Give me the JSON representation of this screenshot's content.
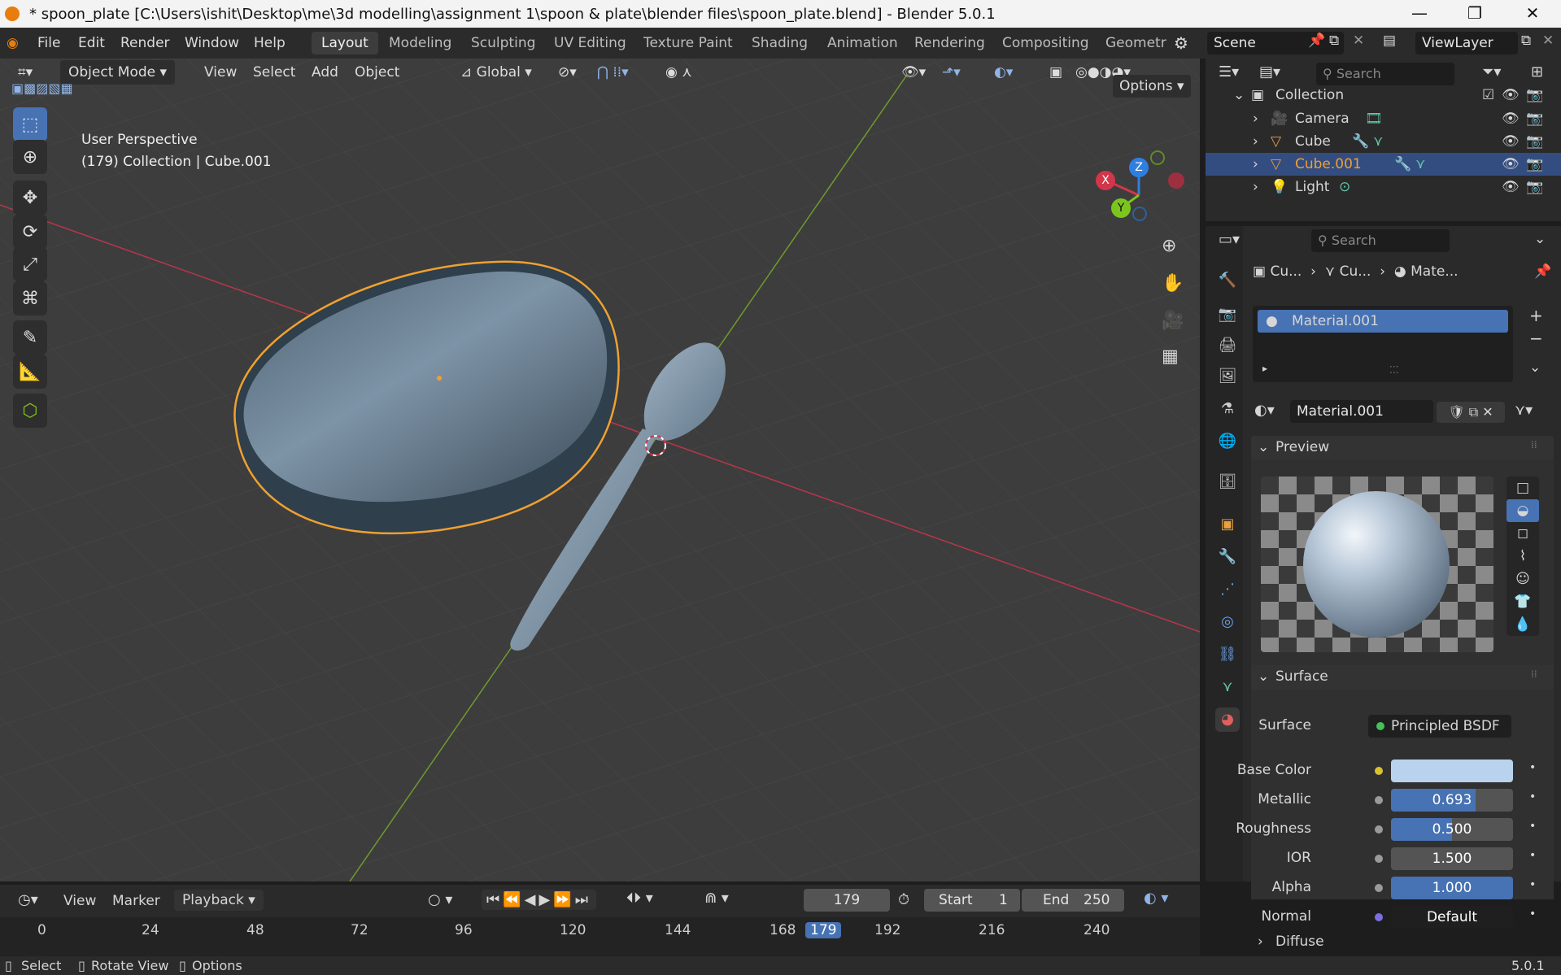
{
  "window": {
    "title": "* spoon_plate [C:\\Users\\ishit\\Desktop\\me\\3d modelling\\assignment 1\\spoon & plate\\blender files\\spoon_plate.blend] - Blender 5.0.1",
    "minimize": "—",
    "maximize": "❐",
    "close": "✕"
  },
  "menu": {
    "file": "File",
    "edit": "Edit",
    "render": "Render",
    "window": "Window",
    "help": "Help"
  },
  "workspaces": [
    "Layout",
    "Modeling",
    "Sculpting",
    "UV Editing",
    "Texture Paint",
    "Shading",
    "Animation",
    "Rendering",
    "Compositing",
    "Geometr"
  ],
  "scene": {
    "name": "Scene",
    "view_layer": "ViewLayer"
  },
  "viewport": {
    "mode": "Object Mode",
    "view": "View",
    "select": "Select",
    "add": "Add",
    "object": "Object",
    "orientation": "Global",
    "options": "Options",
    "info_line1": "User Perspective",
    "info_line2": "(179) Collection | Cube.001",
    "gizmo": {
      "x": "X",
      "y": "Y",
      "z": "Z"
    }
  },
  "outliner": {
    "search_placeholder": "Search",
    "collection": "Collection",
    "items": [
      "Camera",
      "Cube",
      "Cube.001",
      "Light"
    ],
    "selected": "Cube.001"
  },
  "properties": {
    "search_placeholder": "Search",
    "breadcrumb": [
      "Cu...",
      "Cu...",
      "Mate..."
    ],
    "slot": "Material.001",
    "material_name": "Material.001",
    "preview_header": "Preview",
    "surface_header": "Surface",
    "surface_label": "Surface",
    "surface_value": "Principled BSDF",
    "fields": [
      {
        "label": "Base Color",
        "value": "",
        "fill": 1.0,
        "color": "#b9d2ee"
      },
      {
        "label": "Metallic",
        "value": "0.693",
        "fill": 0.693
      },
      {
        "label": "Roughness",
        "value": "0.500",
        "fill": 0.5
      },
      {
        "label": "IOR",
        "value": "1.500",
        "fill": 0
      },
      {
        "label": "Alpha",
        "value": "1.000",
        "fill": 1.0
      },
      {
        "label": "Normal",
        "value": "Default",
        "fill": 0
      }
    ],
    "diffuse_header": "Diffuse"
  },
  "timeline": {
    "view": "View",
    "marker": "Marker",
    "playback": "Playback",
    "current_frame": "179",
    "start_label": "Start",
    "start": "1",
    "end_label": "End",
    "end": "250",
    "frames": [
      "0",
      "24",
      "48",
      "72",
      "96",
      "120",
      "144",
      "168",
      "179",
      "192",
      "216",
      "240"
    ]
  },
  "statusbar": {
    "select": "Select",
    "rotate": "Rotate View",
    "options": "Options",
    "version": "5.0.1"
  },
  "colors": {
    "accent": "#4772b3",
    "selection": "#334d80",
    "outline": "#f0a030",
    "x_axis": "#d1364a",
    "y_axis": "#7cc51e",
    "z_axis": "#2f7fe0"
  }
}
